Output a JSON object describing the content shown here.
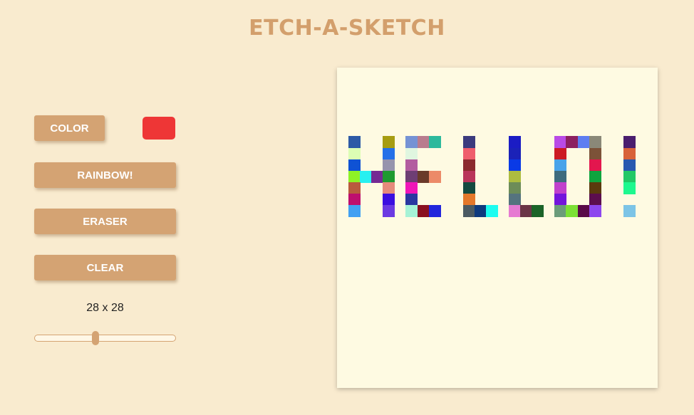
{
  "title": "ETCH-A-SKETCH",
  "controls": {
    "color_label": "COLOR",
    "selected_color": "#ee3636",
    "rainbow_label": "RAINBOW!",
    "eraser_label": "ERASER",
    "clear_label": "CLEAR",
    "size_label": "28 x 28",
    "grid_size": 28,
    "slider_min": 1,
    "slider_max": 64
  },
  "canvas": {
    "background": "#fefae2",
    "grid_size": 28,
    "painted_cells": [
      {
        "row": 6,
        "col": 1,
        "color": "#2d5aa6"
      },
      {
        "row": 6,
        "col": 4,
        "color": "#a69c11"
      },
      {
        "row": 6,
        "col": 6,
        "color": "#7592d4"
      },
      {
        "row": 6,
        "col": 7,
        "color": "#b97c8e"
      },
      {
        "row": 6,
        "col": 8,
        "color": "#2db99c"
      },
      {
        "row": 6,
        "col": 11,
        "color": "#3b3a7d"
      },
      {
        "row": 6,
        "col": 15,
        "color": "#1b1cc4"
      },
      {
        "row": 6,
        "col": 19,
        "color": "#b94ae6"
      },
      {
        "row": 6,
        "col": 20,
        "color": "#8c2060"
      },
      {
        "row": 6,
        "col": 21,
        "color": "#5e7df1"
      },
      {
        "row": 6,
        "col": 22,
        "color": "#8a8878"
      },
      {
        "row": 6,
        "col": 25,
        "color": "#4a1d6e"
      },
      {
        "row": 7,
        "col": 1,
        "color": "#dcfdb4"
      },
      {
        "row": 7,
        "col": 4,
        "color": "#2470e8"
      },
      {
        "row": 7,
        "col": 6,
        "color": "#e0f6e0"
      },
      {
        "row": 7,
        "col": 11,
        "color": "#ef5d6c"
      },
      {
        "row": 7,
        "col": 15,
        "color": "#1b22b8"
      },
      {
        "row": 7,
        "col": 19,
        "color": "#cc1a24"
      },
      {
        "row": 7,
        "col": 22,
        "color": "#7c5238"
      },
      {
        "row": 7,
        "col": 25,
        "color": "#d8623a"
      },
      {
        "row": 8,
        "col": 1,
        "color": "#0f52d4"
      },
      {
        "row": 8,
        "col": 4,
        "color": "#9694ad"
      },
      {
        "row": 8,
        "col": 6,
        "color": "#b35ca0"
      },
      {
        "row": 8,
        "col": 11,
        "color": "#8b2a2e"
      },
      {
        "row": 8,
        "col": 15,
        "color": "#0a3ae6"
      },
      {
        "row": 8,
        "col": 19,
        "color": "#48a3ea"
      },
      {
        "row": 8,
        "col": 22,
        "color": "#e3164e"
      },
      {
        "row": 8,
        "col": 25,
        "color": "#2858b0"
      },
      {
        "row": 9,
        "col": 1,
        "color": "#8ef226"
      },
      {
        "row": 9,
        "col": 2,
        "color": "#28f0f0"
      },
      {
        "row": 9,
        "col": 3,
        "color": "#752a93"
      },
      {
        "row": 9,
        "col": 4,
        "color": "#1e9a30"
      },
      {
        "row": 9,
        "col": 6,
        "color": "#6e3e74"
      },
      {
        "row": 9,
        "col": 7,
        "color": "#6a3a2a"
      },
      {
        "row": 9,
        "col": 8,
        "color": "#ec8a68"
      },
      {
        "row": 9,
        "col": 11,
        "color": "#b9355a"
      },
      {
        "row": 9,
        "col": 15,
        "color": "#adbc40"
      },
      {
        "row": 9,
        "col": 19,
        "color": "#3d6b7e"
      },
      {
        "row": 9,
        "col": 22,
        "color": "#0fa43e"
      },
      {
        "row": 9,
        "col": 25,
        "color": "#22c866"
      },
      {
        "row": 10,
        "col": 1,
        "color": "#b95a3e"
      },
      {
        "row": 10,
        "col": 4,
        "color": "#e58a7c"
      },
      {
        "row": 10,
        "col": 6,
        "color": "#f016b8"
      },
      {
        "row": 10,
        "col": 11,
        "color": "#134a40"
      },
      {
        "row": 10,
        "col": 15,
        "color": "#6d8c58"
      },
      {
        "row": 10,
        "col": 19,
        "color": "#c040cc"
      },
      {
        "row": 10,
        "col": 22,
        "color": "#5b3a0e"
      },
      {
        "row": 10,
        "col": 25,
        "color": "#1ef88e"
      },
      {
        "row": 11,
        "col": 1,
        "color": "#be0e6e"
      },
      {
        "row": 11,
        "col": 4,
        "color": "#3a0ee0"
      },
      {
        "row": 11,
        "col": 6,
        "color": "#2a38a0"
      },
      {
        "row": 11,
        "col": 11,
        "color": "#e4782a"
      },
      {
        "row": 11,
        "col": 15,
        "color": "#55737e"
      },
      {
        "row": 11,
        "col": 19,
        "color": "#7314dc"
      },
      {
        "row": 11,
        "col": 22,
        "color": "#5c0e4e"
      },
      {
        "row": 12,
        "col": 1,
        "color": "#42a0f2"
      },
      {
        "row": 12,
        "col": 4,
        "color": "#6b3ae2"
      },
      {
        "row": 12,
        "col": 6,
        "color": "#a6f2d6"
      },
      {
        "row": 12,
        "col": 7,
        "color": "#8a1020"
      },
      {
        "row": 12,
        "col": 8,
        "color": "#2226dc"
      },
      {
        "row": 12,
        "col": 11,
        "color": "#4b5a62"
      },
      {
        "row": 12,
        "col": 12,
        "color": "#0e3a7e"
      },
      {
        "row": 12,
        "col": 13,
        "color": "#1efcf0"
      },
      {
        "row": 12,
        "col": 15,
        "color": "#e67ad2"
      },
      {
        "row": 12,
        "col": 16,
        "color": "#6a3446"
      },
      {
        "row": 12,
        "col": 17,
        "color": "#1b6328"
      },
      {
        "row": 12,
        "col": 19,
        "color": "#6b9c7a"
      },
      {
        "row": 12,
        "col": 20,
        "color": "#7ce036"
      },
      {
        "row": 12,
        "col": 21,
        "color": "#5a0a48"
      },
      {
        "row": 12,
        "col": 22,
        "color": "#8e46ee"
      },
      {
        "row": 12,
        "col": 25,
        "color": "#7cc4e6"
      }
    ]
  }
}
